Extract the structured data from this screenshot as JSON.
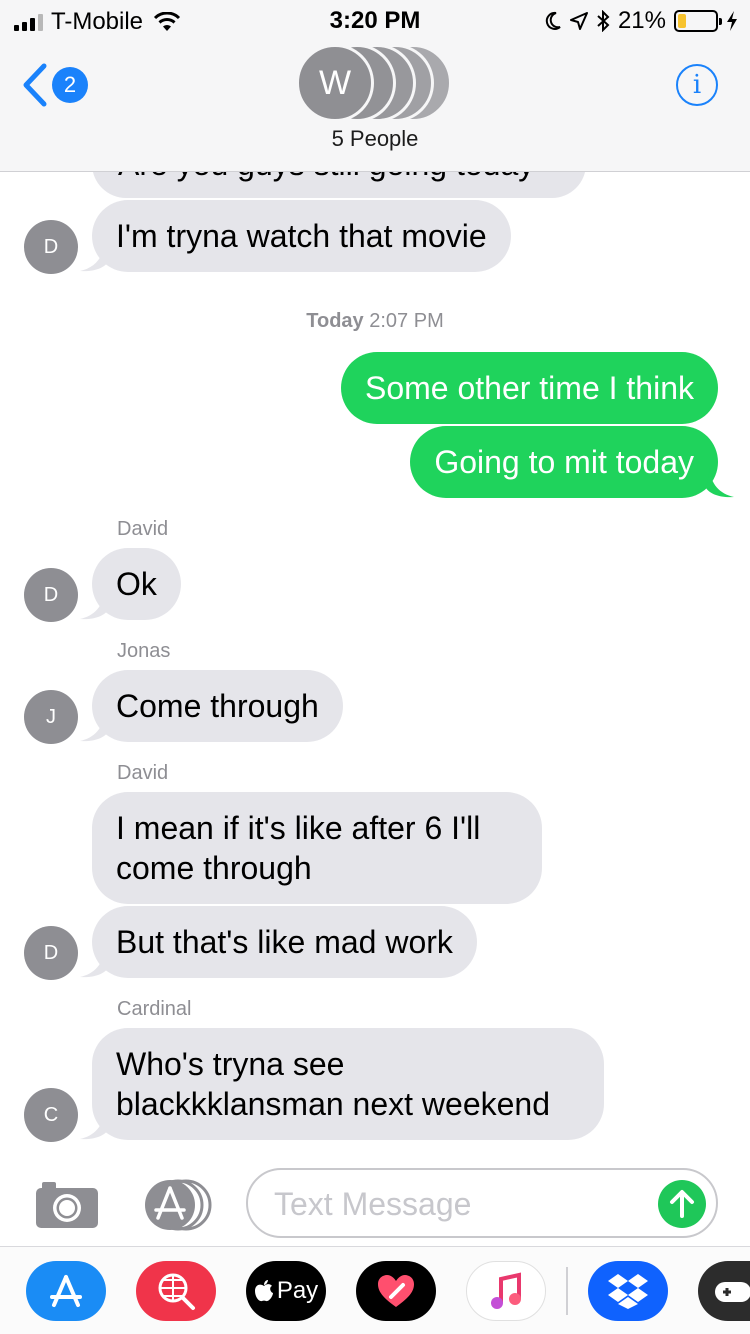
{
  "status_bar": {
    "carrier": "T-Mobile",
    "time": "3:20 PM",
    "battery_percent": "21%",
    "battery_level": 0.21,
    "icons": [
      "signal-icon",
      "wifi-icon",
      "moon-icon",
      "location-icon",
      "bluetooth-icon",
      "battery-icon",
      "charging-icon"
    ]
  },
  "nav": {
    "back_count": "2",
    "group_initial": "W",
    "participants_label": "5 People",
    "info_label": "i"
  },
  "conversation": {
    "partial_top_text": "Are you guys still going today",
    "messages_before": [
      {
        "sender_initial": "D",
        "text": "I'm tryna watch that movie"
      }
    ],
    "timestamp_day": "Today",
    "timestamp_time": "2:07 PM",
    "sent": [
      {
        "text": "Some other time I think"
      },
      {
        "text": "Going to mit today"
      }
    ],
    "groups": [
      {
        "sender": "David",
        "initial": "D",
        "messages": [
          "Ok"
        ]
      },
      {
        "sender": "Jonas",
        "initial": "J",
        "messages": [
          "Come through"
        ]
      },
      {
        "sender": "David",
        "initial": "D",
        "messages": [
          "I mean if it's like after 6 I'll come through",
          "But that's like mad work"
        ]
      },
      {
        "sender": "Cardinal",
        "initial": "C",
        "messages": [
          "Who's tryna see blackkklansman next weekend"
        ]
      }
    ]
  },
  "composer": {
    "placeholder": "Text Message",
    "value": ""
  },
  "app_drawer": {
    "apps": [
      {
        "name": "app-store-icon",
        "color": "#1a8cf5"
      },
      {
        "name": "web-search-icon",
        "color": "#f0344a"
      },
      {
        "name": "apple-pay-icon",
        "color": "#000000",
        "label": "Pay"
      },
      {
        "name": "digital-touch-icon",
        "color": "#000000"
      },
      {
        "name": "music-icon",
        "color": "#ffffff"
      },
      {
        "name": "dropbox-icon",
        "color": "#0f62fe"
      },
      {
        "name": "game-icon",
        "color": "#2c2c2c"
      }
    ]
  },
  "colors": {
    "ios_blue": "#1a82fb",
    "incoming_bubble": "#e5e5ea",
    "sms_green": "#1fd35c",
    "meta_gray": "#8e8e93"
  }
}
